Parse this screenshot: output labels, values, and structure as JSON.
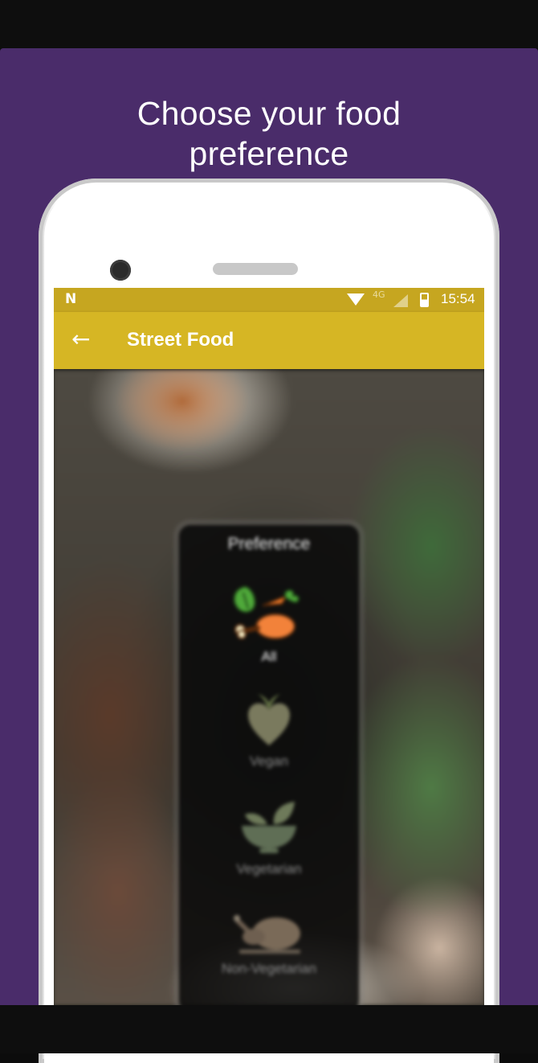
{
  "promo": {
    "headline": "Choose your food\npreference",
    "background_color": "#4a2c6a"
  },
  "status_bar": {
    "time": "15:54",
    "network": "4G",
    "notification_icon": "N"
  },
  "app_bar": {
    "title": "Street Food",
    "back_icon": "←",
    "color": "#d6b624"
  },
  "dialog": {
    "title": "Preference",
    "options": [
      {
        "label": "All",
        "icon": "mixed-food-icon",
        "selected": true
      },
      {
        "label": "Vegan",
        "icon": "vegan-heart-icon",
        "selected": false
      },
      {
        "label": "Vegetarian",
        "icon": "vegetarian-bowl-icon",
        "selected": false
      },
      {
        "label": "Non-Vegetarian",
        "icon": "roast-chicken-icon",
        "selected": false
      }
    ]
  }
}
